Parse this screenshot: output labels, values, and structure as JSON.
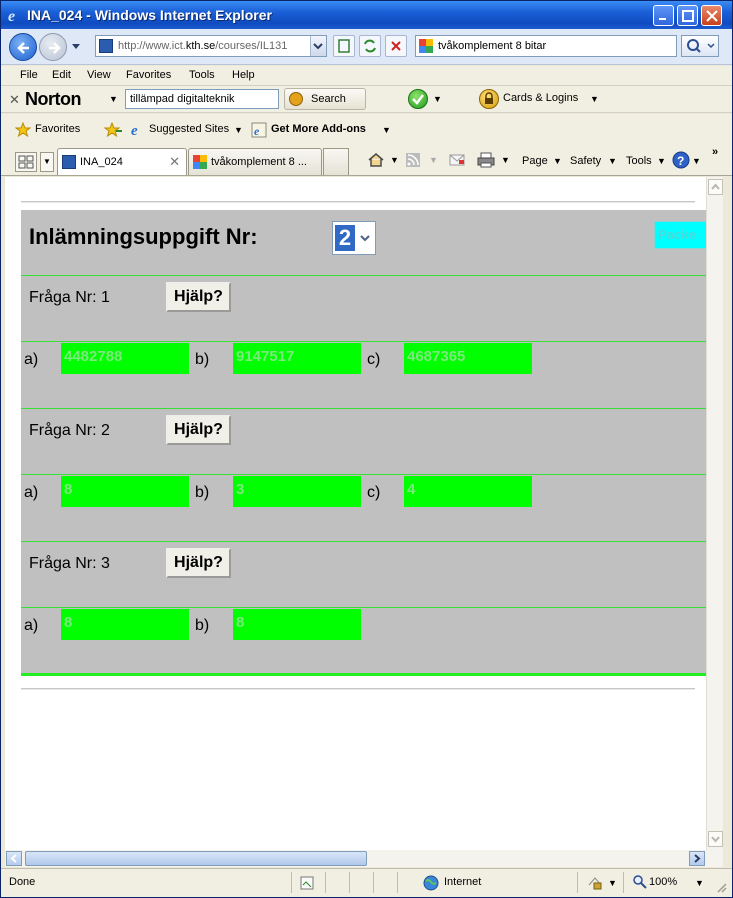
{
  "window": {
    "title": "INA_024 - Windows Internet Explorer"
  },
  "address_bar": {
    "url_prefix": "http://www.ict.",
    "url_domain": "kth.se",
    "url_suffix": "/courses/IL131"
  },
  "search": {
    "query": "tvåkomplement 8 bitar"
  },
  "menu": {
    "items": [
      "File",
      "Edit",
      "View",
      "Favorites",
      "Tools",
      "Help"
    ]
  },
  "norton": {
    "brand": "Norton",
    "search_value": "tillämpad digitalteknik",
    "search_button": "Search",
    "cards_label": "Cards & Logins"
  },
  "favorites_bar": {
    "favorites_label": "Favorites",
    "suggested_sites": "Suggested Sites",
    "get_more_addons": "Get More Add-ons"
  },
  "tabs": [
    {
      "label": "INA_024",
      "active": true
    },
    {
      "label": "tvåkomplement 8 ...",
      "active": false
    }
  ],
  "command_bar": {
    "page": "Page",
    "safety": "Safety",
    "tools": "Tools"
  },
  "page": {
    "heading": "Inlämningsuppgift Nr:",
    "assignment_number": "2",
    "partial_button": "Packe",
    "questions": [
      {
        "label": "Fråga Nr: 1",
        "help": "Hjälp?",
        "answers": [
          {
            "letter": "a)",
            "value": "4482788"
          },
          {
            "letter": "b)",
            "value": "9147517"
          },
          {
            "letter": "c)",
            "value": "4687365"
          }
        ]
      },
      {
        "label": "Fråga Nr: 2",
        "help": "Hjälp?",
        "answers": [
          {
            "letter": "a)",
            "value": "8"
          },
          {
            "letter": "b)",
            "value": "3"
          },
          {
            "letter": "c)",
            "value": "4"
          }
        ]
      },
      {
        "label": "Fråga Nr: 3",
        "help": "Hjälp?",
        "answers": [
          {
            "letter": "a)",
            "value": "8"
          },
          {
            "letter": "b)",
            "value": "8"
          }
        ]
      }
    ]
  },
  "status_bar": {
    "status": "Done",
    "zone": "Internet",
    "zoom": "100%"
  },
  "colors": {
    "panel_bg": "#c0c0c0",
    "answer_field": "#00ff00",
    "separator": "#37e037",
    "cyan_button": "#00ffff",
    "selected_value": "#316ac5"
  }
}
